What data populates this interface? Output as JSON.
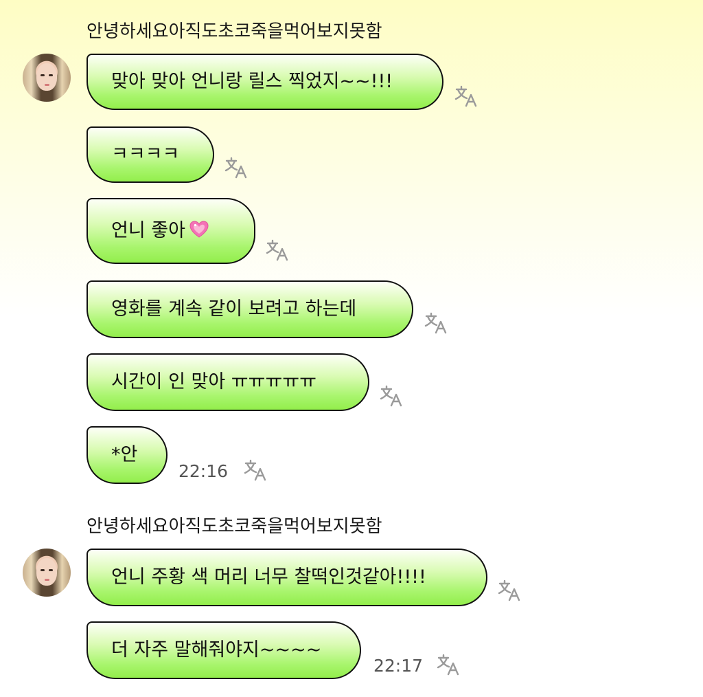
{
  "groups": [
    {
      "sender": "안녕하세요아직도초코죽을먹어보지못함",
      "avatar_icon": "profile-photo",
      "messages": [
        "맞아 맞아 언니랑 릴스 찍었지~~!!!",
        "ㅋㅋㅋㅋ",
        "언니 좋아",
        "영화를 계속 같이 보려고 하는데",
        "시간이 인 맞아 ㅠㅠㅠㅠㅠ",
        "*안"
      ],
      "heart_emoji": "💗",
      "time": "22:16"
    },
    {
      "sender": "안녕하세요아직도초코죽을먹어보지못함",
      "avatar_icon": "profile-photo",
      "messages": [
        "언니 주황 색 머리 너무 찰떡인것같아!!!!",
        "더 자주 말해줘야지~~~~"
      ],
      "time": "22:17"
    }
  ],
  "translate_icon": "translate-icon",
  "colors": {
    "bubble_top": "#fdfff7",
    "bubble_bottom": "#93ee4c",
    "bubble_border": "#111111",
    "background_top": "#fefdc4",
    "timestamp": "#555555",
    "translate_icon": "#9a9a9a"
  }
}
